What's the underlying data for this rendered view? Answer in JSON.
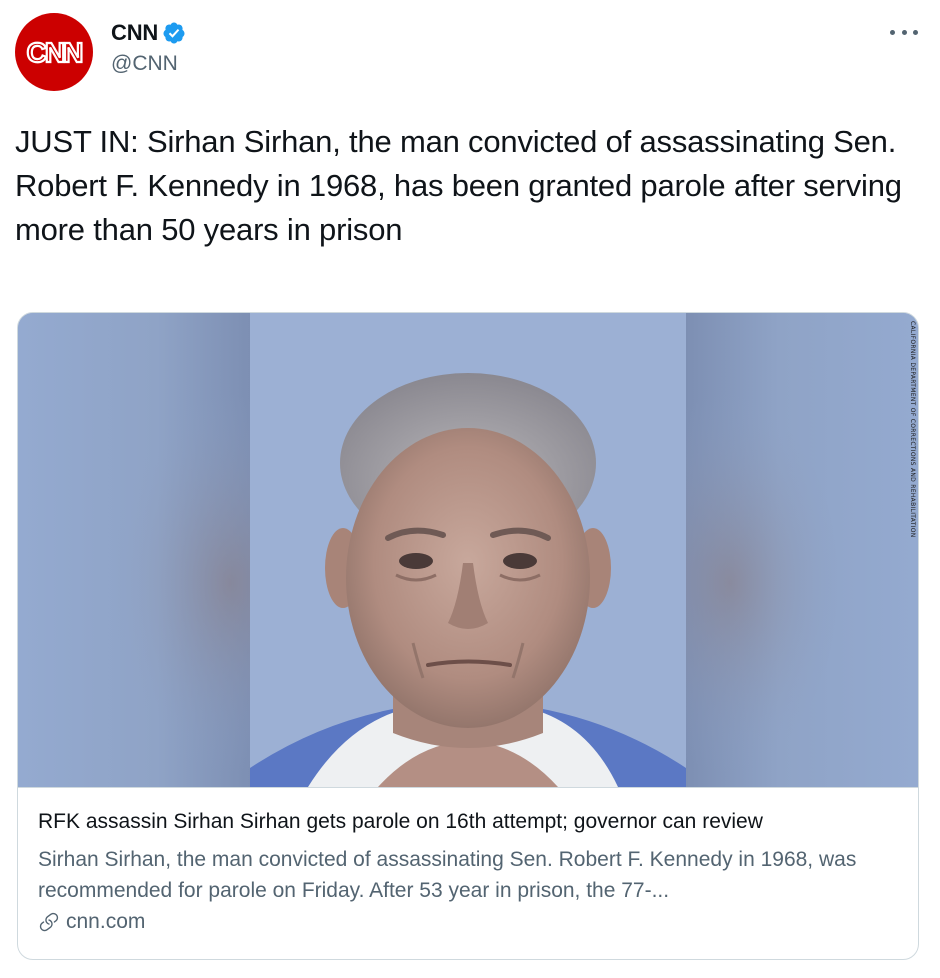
{
  "author": {
    "display_name": "CNN",
    "handle": "@CNN",
    "avatar_text": "CNN",
    "verified": true,
    "avatar_color": "#cc0000",
    "verified_color": "#1d9bf0"
  },
  "tweet": {
    "text": "JUST IN: Sirhan Sirhan, the man convicted of assassinating Sen. Robert F. Kennedy in 1968, has been granted parole after serving more than 50 years in prison"
  },
  "card": {
    "title": "RFK assassin Sirhan Sirhan gets parole on 16th attempt; governor can review",
    "description": "Sirhan Sirhan, the man convicted of assassinating Sen. Robert F. Kennedy in 1968, was recommended for parole on Friday. After 53 year in prison, the 77-...",
    "domain": "cnn.com",
    "image_credit": "CALIFORNIA DEPARTMENT OF CORRECTIONS AND REHABILITATION"
  },
  "icons": {
    "more": "more-icon",
    "verified": "verified-badge-icon",
    "link": "link-icon"
  }
}
